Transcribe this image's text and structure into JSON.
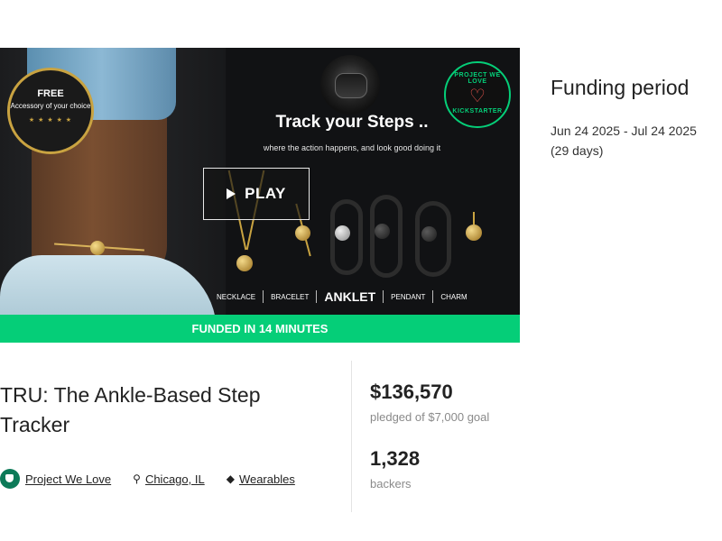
{
  "hero": {
    "badge_free": "FREE",
    "badge_free_sub": "Accessory of your choice",
    "badge_stars": "★ ★ ★ ★ ★",
    "pwl_top": "PROJECT WE LOVE",
    "pwl_bottom": "KICKSTARTER",
    "headline": "Track your Steps ..",
    "subline": "where the action happens, and look good doing it",
    "play_label": "PLAY",
    "categories": [
      "NECKLACE",
      "BRACELET",
      "ANKLET",
      "PENDANT",
      "CHARM"
    ],
    "funded_banner": "FUNDED IN 14 MINUTES"
  },
  "funding": {
    "title": "Funding period",
    "dates": "Jun 24 2025 - Jul 24 2025",
    "days": "(29 days)"
  },
  "project": {
    "title": "TRU: The Ankle-Based Step Tracker",
    "badge": "Project We Love",
    "location": "Chicago, IL",
    "category": "Wearables"
  },
  "stats": {
    "pledged": "$136,570",
    "pledged_goal": "pledged of $7,000 goal",
    "backers": "1,328",
    "backers_label": "backers"
  },
  "colors": {
    "accent_green": "#05ce78",
    "hero_bg": "#111214"
  }
}
